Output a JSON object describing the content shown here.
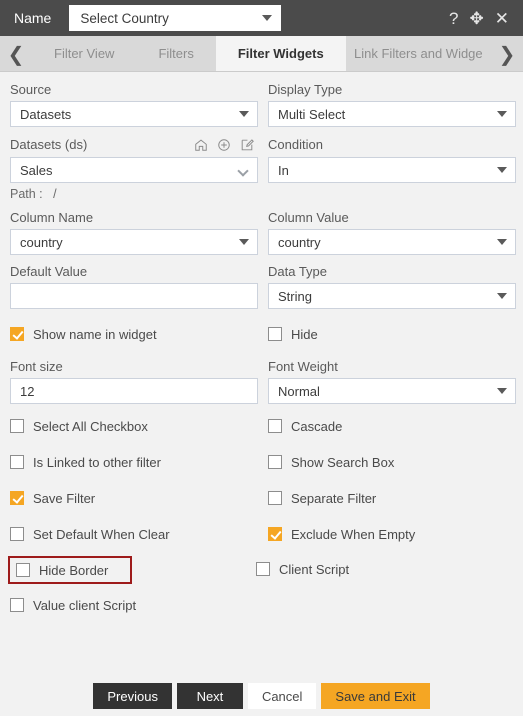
{
  "titlebar": {
    "label": "Name",
    "select_value": "Select Country",
    "icons": [
      {
        "name": "help-icon",
        "glyph": "?"
      },
      {
        "name": "move-icon",
        "glyph": "✥"
      },
      {
        "name": "close-icon",
        "glyph": "✕"
      }
    ]
  },
  "tabbar": {
    "prev_arrow": "❮",
    "next_arrow": "❯",
    "tabs": [
      {
        "label": "Filter View",
        "active": false
      },
      {
        "label": "Filters",
        "active": false
      },
      {
        "label": "Filter Widgets",
        "active": true
      },
      {
        "label": "Link Filters and Widge",
        "active": false
      }
    ]
  },
  "form": {
    "source": {
      "label": "Source",
      "value": "Datasets"
    },
    "display_type": {
      "label": "Display Type",
      "value": "Multi Select"
    },
    "datasets": {
      "label": "Datasets (ds)",
      "value": "Sales",
      "path_label": "Path :",
      "path_value": "/",
      "icons": [
        {
          "name": "home-icon"
        },
        {
          "name": "add-circle-icon"
        },
        {
          "name": "edit-icon"
        }
      ]
    },
    "condition": {
      "label": "Condition",
      "value": "In"
    },
    "column_name": {
      "label": "Column Name",
      "value": "country"
    },
    "column_value": {
      "label": "Column Value",
      "value": "country"
    },
    "default_value": {
      "label": "Default Value",
      "value": "",
      "placeholder": ""
    },
    "data_type": {
      "label": "Data Type",
      "value": "String"
    },
    "font_size": {
      "label": "Font size",
      "value": "12"
    },
    "font_weight": {
      "label": "Font Weight",
      "value": "Normal"
    }
  },
  "checkboxes": [
    {
      "label": "Show name in widget",
      "checked": true,
      "highlight": false
    },
    {
      "label": "Hide",
      "checked": false,
      "highlight": false
    },
    {
      "label": "Select All Checkbox",
      "checked": false,
      "highlight": false
    },
    {
      "label": "Cascade",
      "checked": false,
      "highlight": false
    },
    {
      "label": "Is Linked to other filter",
      "checked": false,
      "highlight": false
    },
    {
      "label": "Show Search Box",
      "checked": false,
      "highlight": false
    },
    {
      "label": "Save Filter",
      "checked": true,
      "highlight": false
    },
    {
      "label": "Separate Filter",
      "checked": false,
      "highlight": false
    },
    {
      "label": "Set Default When Clear",
      "checked": false,
      "highlight": false
    },
    {
      "label": "Exclude When Empty",
      "checked": true,
      "highlight": false
    },
    {
      "label": "Hide Border",
      "checked": false,
      "highlight": true
    },
    {
      "label": "Client Script",
      "checked": false,
      "highlight": false
    },
    {
      "label": "Value client Script",
      "checked": false,
      "highlight": false
    }
  ],
  "footer": {
    "previous": "Previous",
    "next": "Next",
    "cancel": "Cancel",
    "save_and_exit": "Save and Exit"
  },
  "colors": {
    "accent": "#f5a623",
    "titlebar": "#4b4b4b",
    "background": "#f2f2f2",
    "highlight_border": "#9e1b1b",
    "dark_button": "#333333"
  }
}
